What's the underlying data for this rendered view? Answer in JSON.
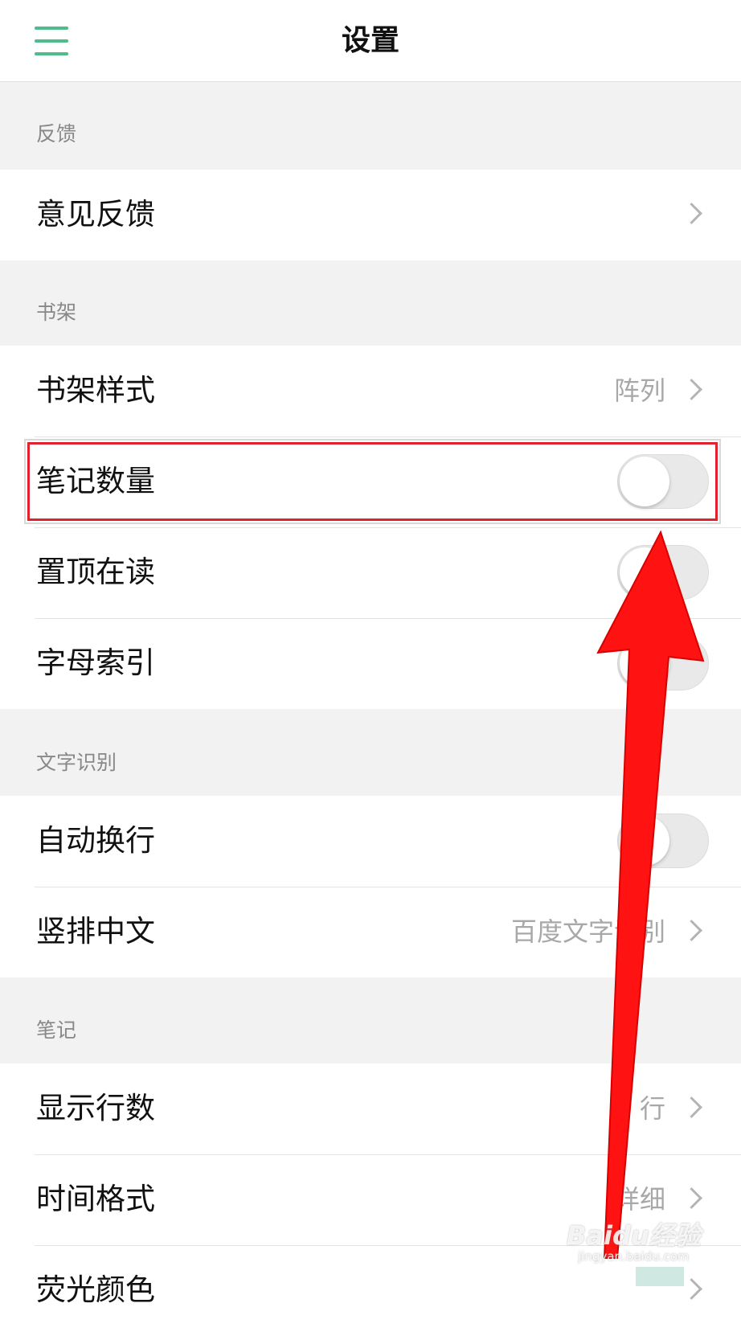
{
  "header": {
    "title": "设置",
    "menu_icon": "hamburger-menu-icon",
    "accent_color": "#4dbb8a"
  },
  "sections": {
    "feedback": {
      "label": "反馈",
      "rows": [
        {
          "label": "意见反馈",
          "control": "chevron"
        }
      ]
    },
    "bookshelf": {
      "label": "书架",
      "rows": [
        {
          "label": "书架样式",
          "value": "阵列",
          "control": "chevron"
        },
        {
          "label": "笔记数量",
          "control": "toggle",
          "on": false
        },
        {
          "label": "置顶在读",
          "control": "toggle",
          "on": false
        },
        {
          "label": "字母索引",
          "control": "toggle",
          "on": false
        }
      ]
    },
    "ocr": {
      "label": "文字识别",
      "rows": [
        {
          "label": "自动换行",
          "control": "toggle",
          "on": false
        },
        {
          "label": "竖排中文",
          "value": "百度文字识别",
          "control": "chevron"
        }
      ]
    },
    "notes": {
      "label": "笔记",
      "rows": [
        {
          "label": "显示行数",
          "value": "3 行",
          "control": "chevron"
        },
        {
          "label": "时间格式",
          "value": "详细",
          "control": "chevron"
        },
        {
          "label": "荧光颜色",
          "control": "chevron"
        }
      ]
    }
  },
  "annotation": {
    "highlight_color": "#e0212e",
    "arrow_color": "#ff1212"
  },
  "watermark": {
    "main": "Baidu经验",
    "sub": "jingyan.baidu.com"
  }
}
